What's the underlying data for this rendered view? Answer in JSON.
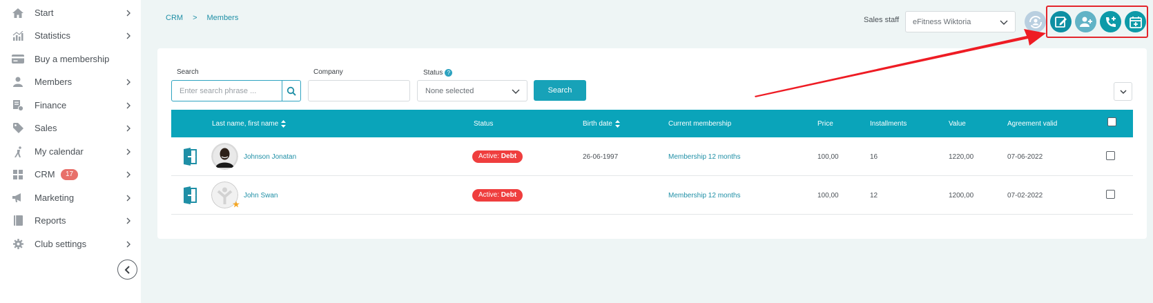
{
  "sidebar": {
    "items": [
      {
        "label": "Start",
        "icon": "home-icon",
        "chevron": true
      },
      {
        "label": "Statistics",
        "icon": "chart-icon",
        "chevron": true
      },
      {
        "label": "Buy a membership",
        "icon": "card-icon",
        "chevron": false
      },
      {
        "label": "Members",
        "icon": "user-icon",
        "chevron": true
      },
      {
        "label": "Finance",
        "icon": "finance-icon",
        "chevron": true
      },
      {
        "label": "Sales",
        "icon": "tag-icon",
        "chevron": true
      },
      {
        "label": "My calendar",
        "icon": "runner-icon",
        "chevron": true
      },
      {
        "label": "CRM",
        "icon": "grid-icon",
        "chevron": true,
        "badge": "17"
      },
      {
        "label": "Marketing",
        "icon": "megaphone-icon",
        "chevron": true
      },
      {
        "label": "Reports",
        "icon": "book-icon",
        "chevron": true
      },
      {
        "label": "Club settings",
        "icon": "gear-icon",
        "chevron": true
      }
    ]
  },
  "breadcrumb": {
    "items": [
      "CRM",
      "Members"
    ],
    "separator": ">"
  },
  "header": {
    "sales_staff_label": "Sales staff",
    "sales_staff_value": "eFitness Wiktoria"
  },
  "filters": {
    "search_label": "Search",
    "search_placeholder": "Enter search phrase ...",
    "company_label": "Company",
    "status_label": "Status",
    "status_help": "?",
    "status_value": "None selected",
    "search_button": "Search"
  },
  "table": {
    "columns": [
      "Last name, first name",
      "Status",
      "Birth date",
      "Current membership",
      "Price",
      "Installments",
      "Value",
      "Agreement valid"
    ],
    "rows": [
      {
        "name": "Johnson Jonatan",
        "status_prefix": "Active:",
        "status_value": "Debt",
        "birth_date": "26-06-1997",
        "membership": "Membership 12 months",
        "price": "100,00",
        "installments": "16",
        "value": "1220,00",
        "agreement_valid": "07-06-2022"
      },
      {
        "name": "John Swan",
        "status_prefix": "Active:",
        "status_value": "Debt",
        "birth_date": "",
        "membership": "Membership 12 months",
        "price": "100,00",
        "installments": "12",
        "value": "1200,00",
        "agreement_valid": "07-02-2022"
      }
    ]
  },
  "colors": {
    "accent": "#0aa4ba",
    "status_debt": "#ef3e3e",
    "highlight": "#e3242b"
  }
}
